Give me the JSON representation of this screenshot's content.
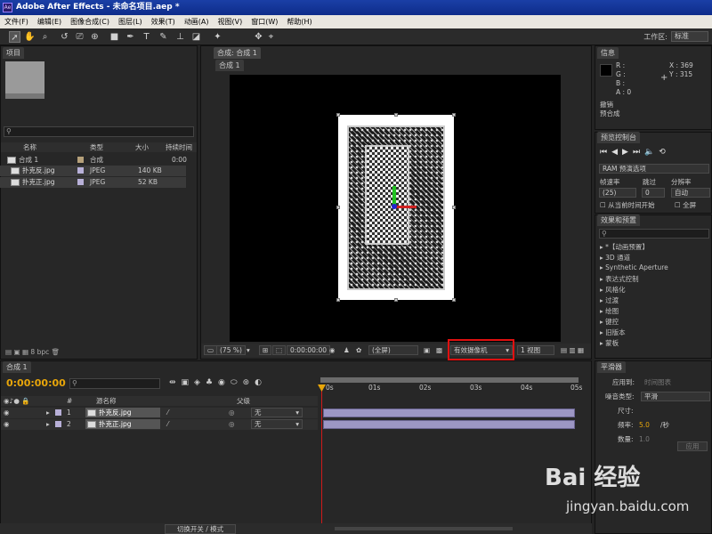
{
  "app": {
    "title": "Adobe After Effects - 未命名项目.aep *",
    "logo_text": "Ae"
  },
  "menu": [
    "文件(F)",
    "编辑(E)",
    "图像合成(C)",
    "图层(L)",
    "效果(T)",
    "动画(A)",
    "视图(V)",
    "窗口(W)",
    "帮助(H)"
  ],
  "workspace": {
    "label": "工作区:",
    "value": "标准"
  },
  "project": {
    "tab": "项目",
    "columns": {
      "name": "名称",
      "type": "类型",
      "size": "大小",
      "duration": "持续时间"
    },
    "items": [
      {
        "name": "合成 1",
        "type": "合成",
        "size": "",
        "duration": "0:00"
      },
      {
        "name": "扑克反.jpg",
        "type": "JPEG",
        "size": "140 KB",
        "duration": ""
      },
      {
        "name": "扑克正.jpg",
        "type": "JPEG",
        "size": "52 KB",
        "duration": ""
      }
    ],
    "bpc": "8 bpc"
  },
  "composition": {
    "tab": "合成: 合成 1",
    "subtab": "合成 1",
    "zoom": "(75 %)",
    "timecode": "0:00:00:00",
    "resolution": "(全屏)",
    "camera": "有效摄像机",
    "views": "1 视图"
  },
  "info": {
    "tab": "信息",
    "r": "R :",
    "g": "G :",
    "b": "B :",
    "a": "A : 0",
    "x": "X : 369",
    "y": "Y : 315",
    "line1": "撤销",
    "line2": "预合成"
  },
  "preview": {
    "tab": "预览控制台",
    "ram": "RAM 预演选项",
    "framerate": "帧速率",
    "skip": "跳过",
    "resolution": "分辨率",
    "fps_value": "(25)",
    "skip_value": "0",
    "res_value": "自动",
    "from_current": "从当前时间开始",
    "fullscreen": "全屏"
  },
  "effects": {
    "tab": "效果和预置",
    "items": [
      "*【动画预置】",
      "3D 通道",
      "Synthetic Aperture",
      "表达式控制",
      "风格化",
      "过渡",
      "绘图",
      "键控",
      "旧版本",
      "蒙板"
    ]
  },
  "smoother": {
    "tab": "平滑器",
    "apply_to": "应用到:",
    "apply_to_value": "时间图表",
    "noise_type": "噪音类型:",
    "noise_value": "平滑",
    "size": "尺寸:",
    "freq": "频率:",
    "freq_value": "5.0",
    "freq_unit": "/秒",
    "amount": "数量:",
    "amount_value": "1.0",
    "apply_btn": "应用"
  },
  "timeline": {
    "tab": "合成 1",
    "timecode": "0:00:00:00",
    "col_source": "源名称",
    "col_parent": "父级",
    "ruler": [
      "0s",
      "01s",
      "02s",
      "03s",
      "04s",
      "05s"
    ],
    "layers": [
      {
        "num": "1",
        "name": "扑克反.jpg",
        "parent": "无"
      },
      {
        "num": "2",
        "name": "扑克正.jpg",
        "parent": "无"
      }
    ],
    "toggle": "切换开关 / 模式"
  },
  "watermark": {
    "brand": "Bai 经验",
    "url": "jingyan.baidu.com"
  }
}
